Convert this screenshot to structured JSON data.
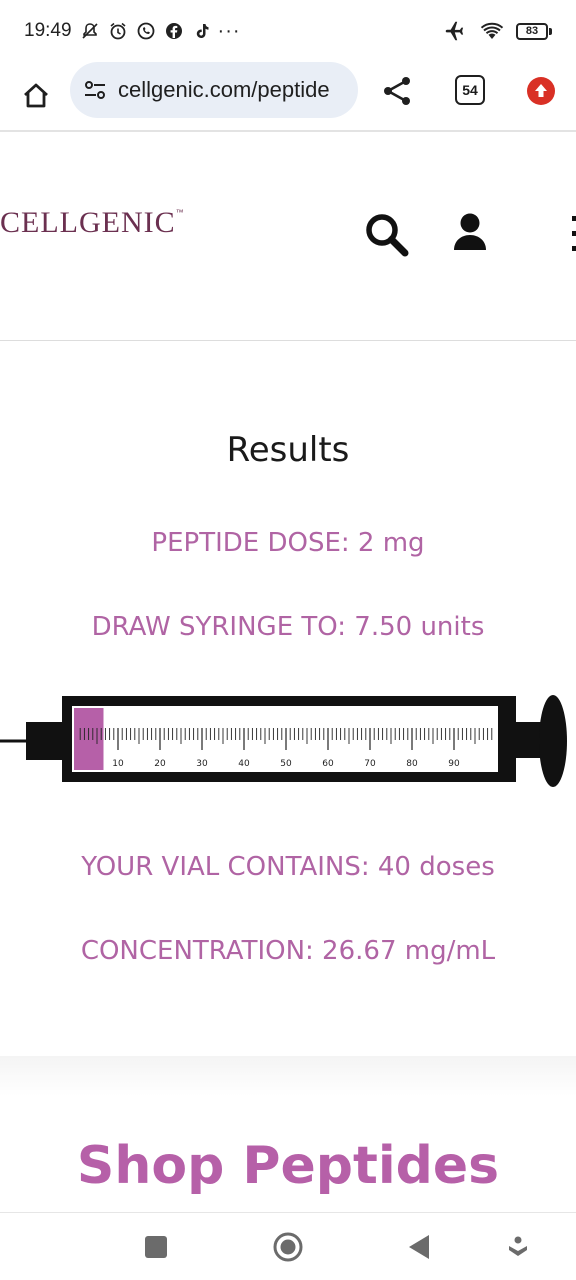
{
  "status_bar": {
    "time": "19:49",
    "more_indicator": "···",
    "battery_level": "83",
    "icons": [
      "mute-icon",
      "alarm-icon",
      "whatsapp-icon",
      "facebook-icon",
      "tiktok-icon",
      "airplane-icon",
      "wifi-icon",
      "battery-icon"
    ]
  },
  "browser": {
    "url": "cellgenic.com/peptide",
    "tab_count": "54",
    "icons": [
      "home-icon",
      "site-settings-icon",
      "share-icon",
      "tabs-icon",
      "update-icon"
    ],
    "accent_color": "#d93025"
  },
  "site": {
    "logo_text": "CELLGENIC",
    "logo_tm": "™",
    "brand_color": "#6b3050",
    "icons": [
      "search-icon",
      "account-icon",
      "menu-icon"
    ]
  },
  "results": {
    "title": "Results",
    "peptide_dose": "PEPTIDE DOSE: 2 mg",
    "draw_syringe": "DRAW SYRINGE TO: 7.50 units",
    "vial_contains": "YOUR VIAL CONTAINS: 40 doses",
    "concentration": "CONCENTRATION: 26.67 mg/mL",
    "text_color": "#b064a4"
  },
  "syringe": {
    "fill_units": 7.5,
    "max_units": 100,
    "scale_labels": [
      "10",
      "20",
      "30",
      "40",
      "50",
      "60",
      "70",
      "80",
      "90"
    ],
    "fill_color": "#b660a8"
  },
  "shop": {
    "title": "Shop Peptides"
  },
  "nav_bar": {
    "icons": [
      "recents-icon",
      "home-circle-icon",
      "back-icon",
      "assistant-icon"
    ]
  }
}
